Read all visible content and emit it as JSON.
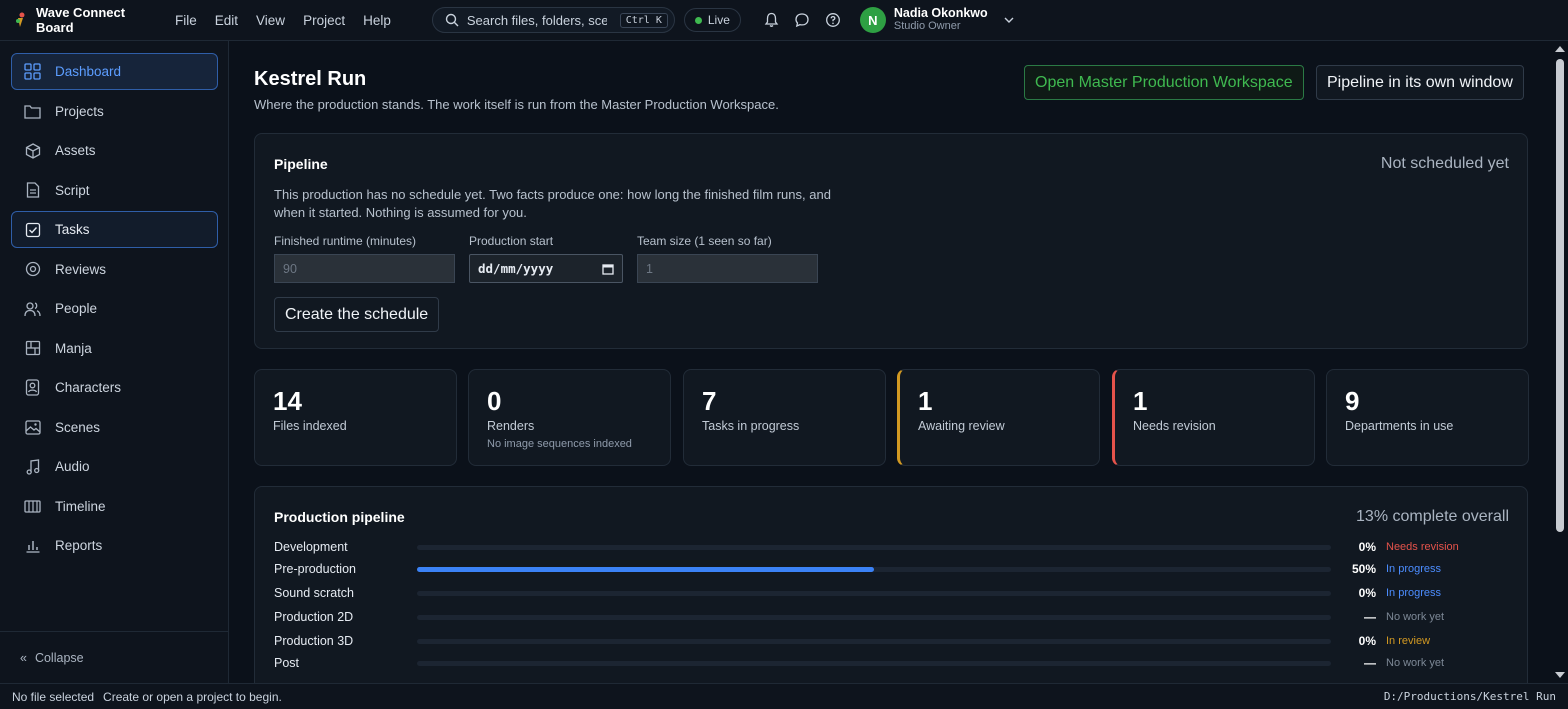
{
  "app": {
    "title": "Wave Connect Board"
  },
  "menu": [
    "File",
    "Edit",
    "View",
    "Project",
    "Help"
  ],
  "search": {
    "placeholder": "Search files, folders, scenes",
    "shortcut": "Ctrl K"
  },
  "live_label": "Live",
  "user": {
    "initial": "N",
    "name": "Nadia Okonkwo",
    "role": "Studio Owner"
  },
  "sidebar": {
    "items": [
      {
        "label": "Dashboard",
        "icon": "dashboard-icon"
      },
      {
        "label": "Projects",
        "icon": "folder-icon"
      },
      {
        "label": "Assets",
        "icon": "cube-icon"
      },
      {
        "label": "Script",
        "icon": "document-icon"
      },
      {
        "label": "Tasks",
        "icon": "checkbox-icon"
      },
      {
        "label": "Reviews",
        "icon": "target-icon"
      },
      {
        "label": "People",
        "icon": "people-icon"
      },
      {
        "label": "Manja",
        "icon": "panels-icon"
      },
      {
        "label": "Characters",
        "icon": "character-icon"
      },
      {
        "label": "Scenes",
        "icon": "image-icon"
      },
      {
        "label": "Audio",
        "icon": "music-icon"
      },
      {
        "label": "Timeline",
        "icon": "timeline-icon"
      },
      {
        "label": "Reports",
        "icon": "chart-icon"
      }
    ],
    "collapse_label": "Collapse"
  },
  "page": {
    "title": "Kestrel Run",
    "subtitle": "Where the production stands. The work itself is run from the Master Production Workspace.",
    "open_workspace_label": "Open Master Production Workspace",
    "pipeline_window_label": "Pipeline in its own window"
  },
  "pipeline": {
    "title": "Pipeline",
    "status": "Not scheduled yet",
    "description": "This production has no schedule yet. Two facts produce one: how long the finished film runs, and when it started. Nothing is assumed for you.",
    "fields": {
      "runtime_label": "Finished runtime (minutes)",
      "runtime_placeholder": "90",
      "start_label": "Production start",
      "start_placeholder": "dd/mm/yyyy",
      "team_label": "Team size (1 seen so far)",
      "team_placeholder": "1"
    },
    "create_label": "Create the schedule"
  },
  "stats": [
    {
      "value": "14",
      "label": "Files indexed",
      "sub": ""
    },
    {
      "value": "0",
      "label": "Renders",
      "sub": "No image sequences indexed"
    },
    {
      "value": "7",
      "label": "Tasks in progress",
      "sub": ""
    },
    {
      "value": "1",
      "label": "Awaiting review",
      "sub": ""
    },
    {
      "value": "1",
      "label": "Needs revision",
      "sub": ""
    },
    {
      "value": "9",
      "label": "Departments in use",
      "sub": ""
    }
  ],
  "production": {
    "title": "Production pipeline",
    "overall": "13% complete overall",
    "rows": [
      {
        "name": "Development",
        "progress": 0,
        "pct": "0%",
        "status": "Needs revision",
        "tone": "red"
      },
      {
        "name": "Pre-production",
        "progress": 50,
        "pct": "50%",
        "status": "In progress",
        "tone": "blue"
      },
      {
        "name": "Sound scratch",
        "progress": 0,
        "pct": "0%",
        "status": "In progress",
        "tone": "blue"
      },
      {
        "name": "Production 2D",
        "progress": 0,
        "pct": "—",
        "status": "No work yet",
        "tone": "gray"
      },
      {
        "name": "Production 3D",
        "progress": 0,
        "pct": "0%",
        "status": "In review",
        "tone": "amber"
      },
      {
        "name": "Post",
        "progress": 0,
        "pct": "—",
        "status": "No work yet",
        "tone": "gray"
      }
    ]
  },
  "statusbar": {
    "file": "No file selected",
    "hint": "Create or open a project to begin.",
    "path": "D:/Productions/Kestrel Run"
  },
  "colors": {
    "accent": "#3b82f6",
    "live": "#3fb950",
    "amber": "#d29922",
    "red": "#e5534b"
  }
}
